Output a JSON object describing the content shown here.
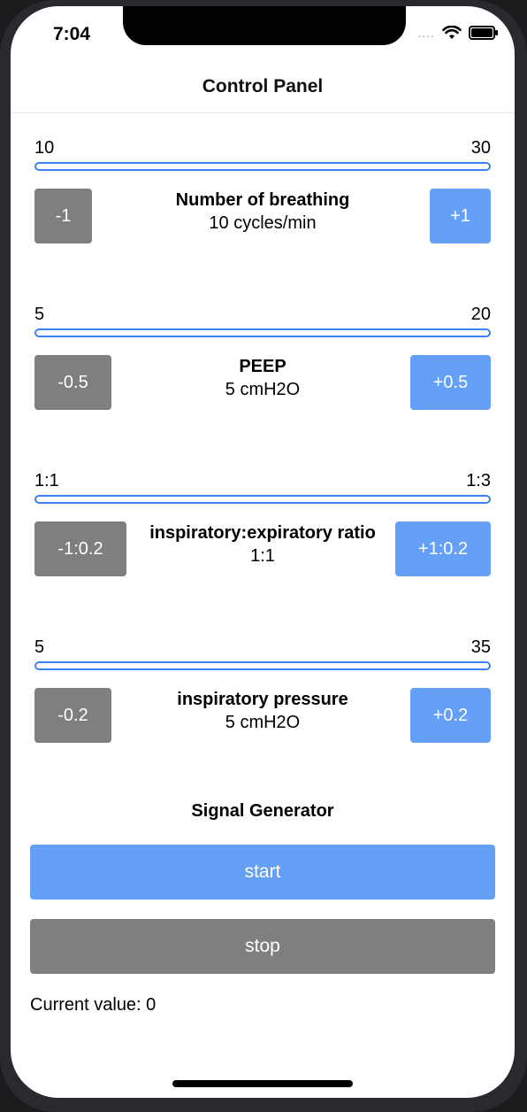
{
  "status_bar": {
    "time": "7:04",
    "signal": "....",
    "wifi_icon": "wifi-icon",
    "battery_icon": "battery-icon"
  },
  "nav": {
    "title": "Control Panel"
  },
  "controls": [
    {
      "min": "10",
      "max": "30",
      "minus": "-1",
      "plus": "+1",
      "name": "Number of breathing",
      "value": "10 cycles/min"
    },
    {
      "min": "5",
      "max": "20",
      "minus": "-0.5",
      "plus": "+0.5",
      "name": "PEEP",
      "value": "5 cmH2O"
    },
    {
      "min": "1:1",
      "max": "1:3",
      "minus": "-1:0.2",
      "plus": "+1:0.2",
      "name": "inspiratory:expiratory ratio",
      "value": "1:1"
    },
    {
      "min": "5",
      "max": "35",
      "minus": "-0.2",
      "plus": "+0.2",
      "name": "inspiratory pressure",
      "value": "5 cmH2O"
    }
  ],
  "signal_generator": {
    "title": "Signal Generator",
    "start_label": "start",
    "stop_label": "stop",
    "current_value": "Current value: 0"
  },
  "colors": {
    "accent": "#64a0f5",
    "slider": "#3b82f6",
    "secondary": "#7f7f7f"
  }
}
